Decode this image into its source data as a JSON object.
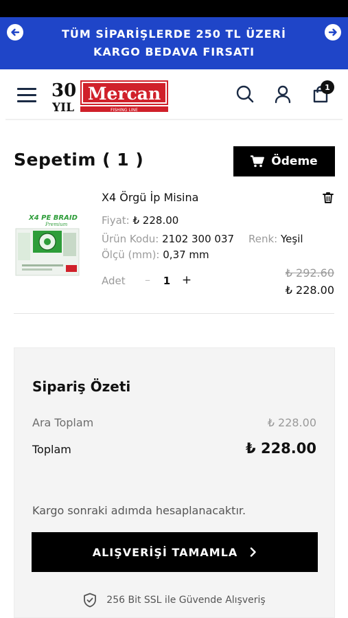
{
  "promo": {
    "text": "TÜM SİPARİŞLERDE 250 TL ÜZERİ KARGO BEDAVA FIRSATI",
    "prev_icon": "arrow-left-icon",
    "next_icon": "arrow-right-icon"
  },
  "header": {
    "logo": {
      "years_number": "30",
      "years_word": "YIL",
      "brand": "Mercan",
      "tagline": "FISHING LINE"
    },
    "cart_count": "1"
  },
  "cart": {
    "title": "Sepetim ( 1 )",
    "checkout_label": "Ödeme",
    "item": {
      "thumbnail_brand": "X4 PE BRAID",
      "thumbnail_sub": "Premium",
      "name": "X4 Örgü İp Misina",
      "price_label": "Fiyat:",
      "price_value": "₺ 228.00",
      "code_label": "Ürün Kodu:",
      "code_value": "2102 300 037",
      "color_label": "Renk:",
      "color_value": "Yeşil",
      "size_label": "Ölçü (mm):",
      "size_value": "0,37 mm",
      "qty_label": "Adet",
      "qty_minus": "–",
      "qty_value": "1",
      "qty_plus": "+",
      "old_price": "₺ 292.60",
      "new_price": "₺ 228.00"
    }
  },
  "summary": {
    "title": "Sipariş Özeti",
    "subtotal_label": "Ara Toplam",
    "subtotal_value": "₺ 228.00",
    "total_label": "Toplam",
    "total_value": "₺ 228.00",
    "shipping_note": "Kargo sonraki adımda hesaplanacaktır.",
    "complete_label": "ALIŞVERİŞİ TAMAMLA",
    "ssl_text": "256 Bit SSL ile Güvende Alışveriş"
  },
  "colors": {
    "promo_bg": "#1f45c8",
    "logo_red": "#d0202a",
    "button_bg": "#000000",
    "summary_bg": "#f4f4f4"
  }
}
